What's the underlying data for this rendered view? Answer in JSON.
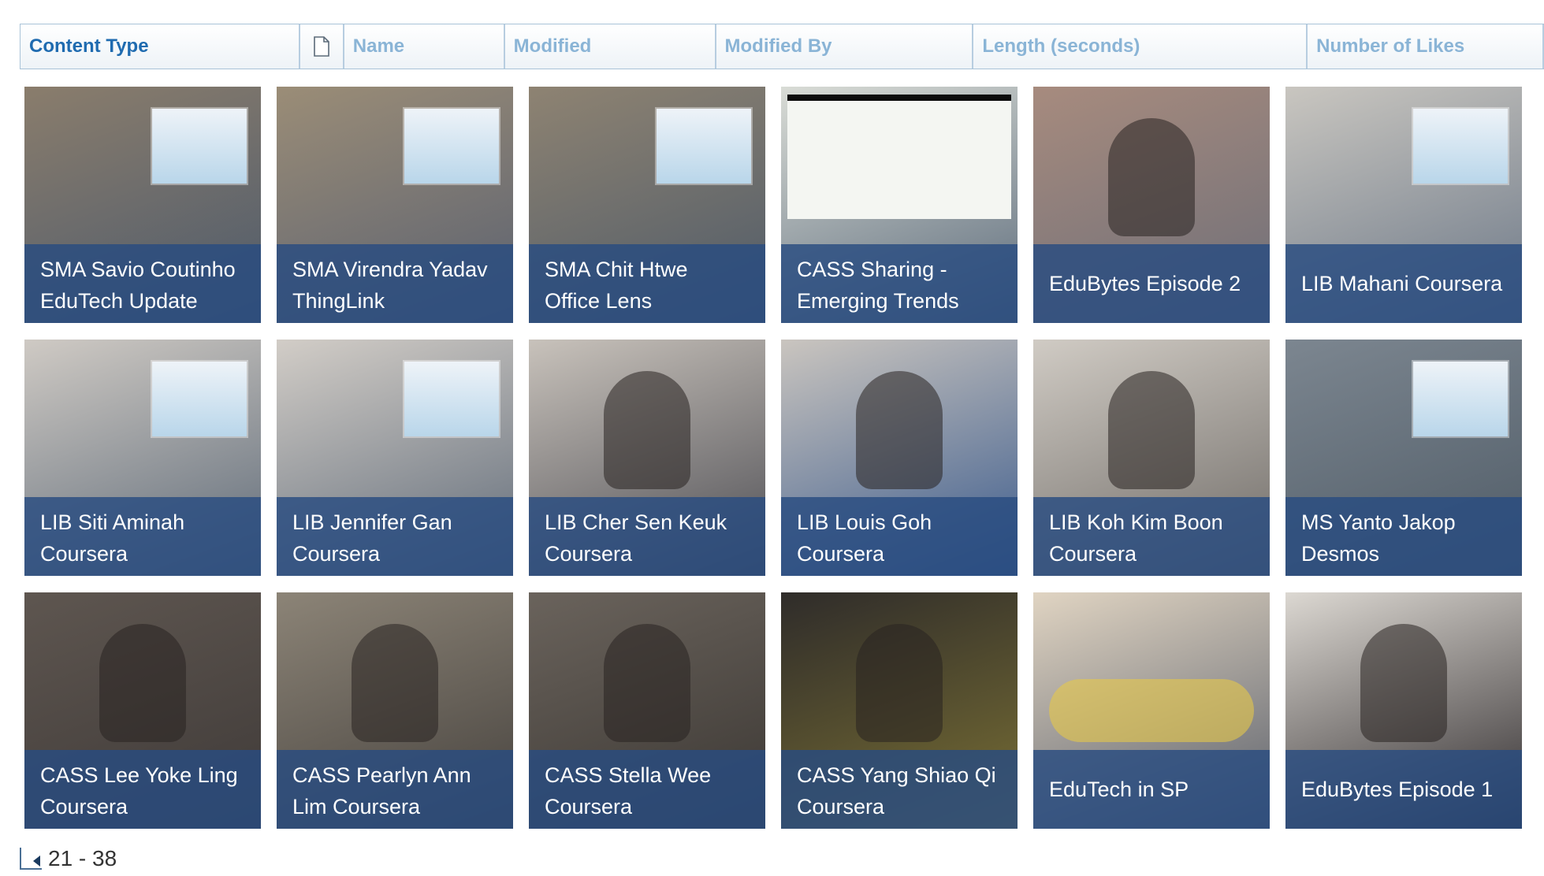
{
  "header": {
    "columns": [
      {
        "label": "Content Type",
        "width": 355,
        "active": true
      },
      {
        "label": "",
        "width": 56,
        "icon": "document-icon"
      },
      {
        "label": "Name",
        "width": 204
      },
      {
        "label": "Modified",
        "width": 268
      },
      {
        "label": "Modified By",
        "width": 327
      },
      {
        "label": "Length (seconds)",
        "width": 424
      },
      {
        "label": "Number of Likes",
        "width": 300
      }
    ]
  },
  "tiles": [
    {
      "lines": [
        "SMA Savio Coutinho",
        "EduTech Update"
      ],
      "name": "tile-sma-savio-coutinho",
      "bg": [
        "#8a7d6c",
        "#4d5a6b"
      ]
    },
    {
      "lines": [
        "SMA Virendra Yadav",
        "ThingLink"
      ],
      "name": "tile-sma-virendra-yadav",
      "bg": [
        "#9b8d77",
        "#596070"
      ]
    },
    {
      "lines": [
        "SMA Chit Htwe",
        "Office Lens"
      ],
      "name": "tile-sma-chit-htwe",
      "bg": [
        "#8e8372",
        "#4e5a68"
      ]
    },
    {
      "lines": [
        "CASS Sharing -",
        "Emerging Trends"
      ],
      "name": "tile-cass-sharing",
      "bg": [
        "#d9dcd6",
        "#5b6a7a"
      ]
    },
    {
      "lines": [
        "EduBytes Episode 2"
      ],
      "name": "tile-edubytes-episode-2",
      "bg": [
        "#a78b7e",
        "#6d6e78"
      ]
    },
    {
      "lines": [
        "LIB Mahani Coursera"
      ],
      "name": "tile-lib-mahani",
      "bg": [
        "#c9c6c0",
        "#6b7787"
      ]
    },
    {
      "lines": [
        "LIB Siti Aminah",
        "Coursera"
      ],
      "name": "tile-lib-siti-aminah",
      "bg": [
        "#cfcac4",
        "#5e6a78"
      ]
    },
    {
      "lines": [
        "LIB Jennifer Gan",
        "Coursera"
      ],
      "name": "tile-lib-jennifer-gan",
      "bg": [
        "#d2cdc7",
        "#606b79"
      ]
    },
    {
      "lines": [
        "LIB Cher Sen Keuk",
        "Coursera"
      ],
      "name": "tile-lib-cher-sen-keuk",
      "bg": [
        "#c8c2bb",
        "#4c4c52"
      ]
    },
    {
      "lines": [
        "LIB Louis Goh",
        "Coursera"
      ],
      "name": "tile-lib-louis-goh",
      "bg": [
        "#cac5bf",
        "#3a5a8c"
      ]
    },
    {
      "lines": [
        "LIB Koh Kim Boon",
        "Coursera"
      ],
      "name": "tile-lib-koh-kim-boon",
      "bg": [
        "#d0cbc4",
        "#6e6a66"
      ]
    },
    {
      "lines": [
        "MS Yanto Jakop",
        "Desmos"
      ],
      "name": "tile-ms-yanto-jakop",
      "bg": [
        "#7c8690",
        "#4f5b66"
      ]
    },
    {
      "lines": [
        "CASS Lee Yoke Ling",
        "Coursera"
      ],
      "name": "tile-cass-lee-yoke-ling",
      "bg": [
        "#5e5650",
        "#3f3a38"
      ]
    },
    {
      "lines": [
        "CASS Pearlyn Ann",
        "Lim Coursera"
      ],
      "name": "tile-cass-pearlyn-ann",
      "bg": [
        "#8c8477",
        "#45413d"
      ]
    },
    {
      "lines": [
        "CASS Stella Wee",
        "Coursera"
      ],
      "name": "tile-cass-stella-wee",
      "bg": [
        "#6a635c",
        "#3b3733"
      ]
    },
    {
      "lines": [
        "CASS Yang Shiao Qi",
        "Coursera"
      ],
      "name": "tile-cass-yang-shiao-qi",
      "bg": [
        "#2f2c2a",
        "#7a7034"
      ]
    },
    {
      "lines": [
        "EduTech in SP"
      ],
      "name": "tile-edutech-in-sp",
      "bg": [
        "#e0d4c2",
        "#5a5f6a"
      ]
    },
    {
      "lines": [
        "EduBytes Episode 1"
      ],
      "name": "tile-edubytes-episode-1",
      "bg": [
        "#dcd8d2",
        "#2e2a2c"
      ]
    }
  ],
  "pager": {
    "range": "21 - 38",
    "prev_icon": "previous-page-icon"
  }
}
